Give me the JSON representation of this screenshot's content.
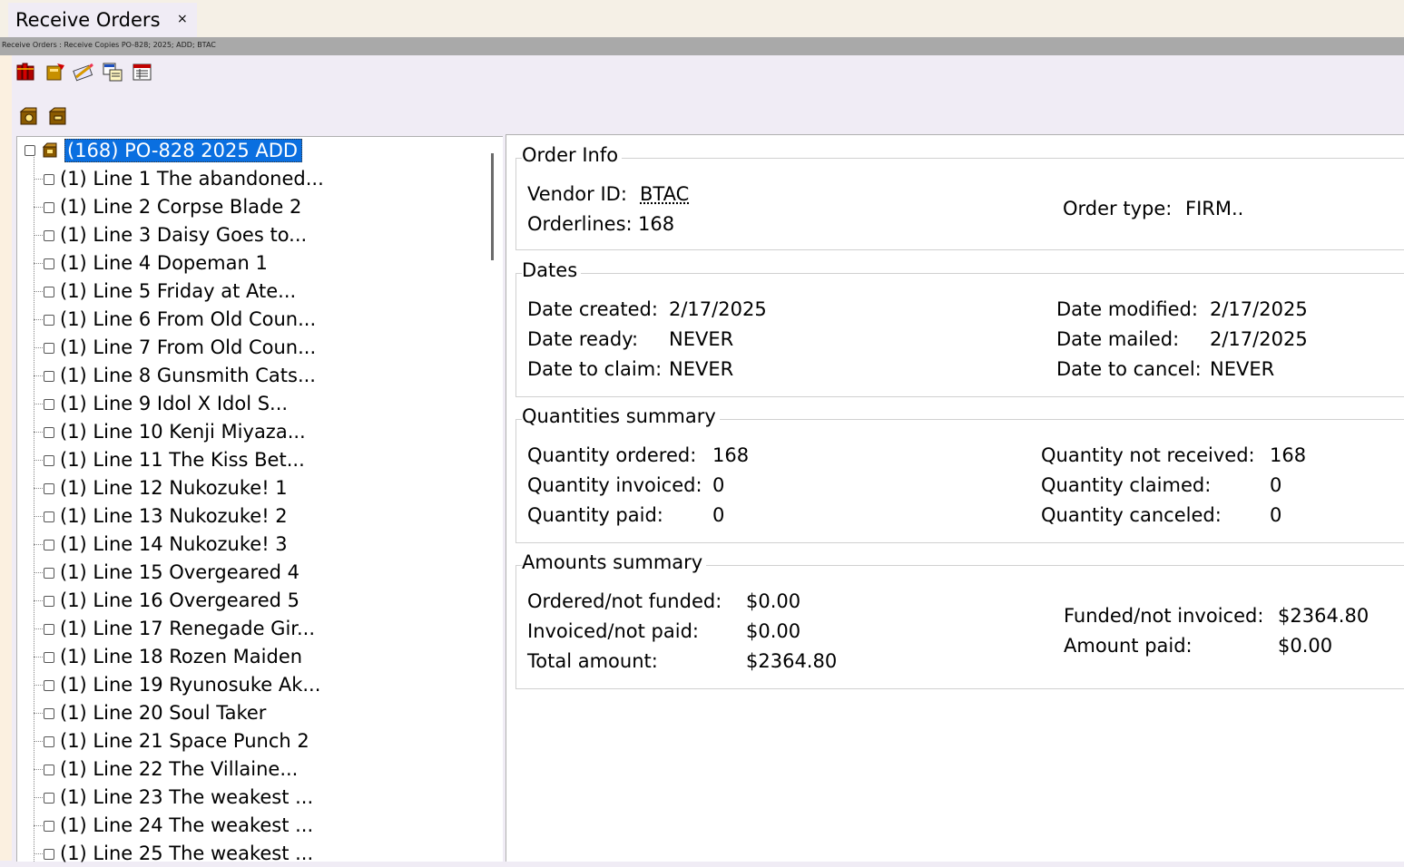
{
  "tab": {
    "title": "Receive Orders",
    "close": "×"
  },
  "breadcrumb": "Receive Orders : Receive Copies  PO-828; 2025; ADD; BTAC",
  "tree": {
    "root": "(168) PO-828 2025 ADD",
    "lines": [
      "(1) Line 1 The abandoned...",
      "(1) Line 2 Corpse Blade 2",
      "(1) Line 3 Daisy Goes to...",
      "(1) Line 4 Dopeman 1",
      "(1) Line 5 Friday at Ate...",
      "(1) Line 6 From Old Coun...",
      "(1) Line 7 From Old Coun...",
      "(1) Line 8 Gunsmith Cats...",
      "(1) Line 9 Idol X Idol S...",
      "(1) Line 10 Kenji Miyaza...",
      "(1) Line 11 The Kiss Bet...",
      "(1) Line 12 Nukozuke! 1",
      "(1) Line 13 Nukozuke! 2",
      "(1) Line 14 Nukozuke! 3",
      "(1) Line 15 Overgeared 4",
      "(1) Line 16 Overgeared 5",
      "(1) Line 17 Renegade Gir...",
      "(1) Line 18 Rozen Maiden",
      "(1) Line 19 Ryunosuke Ak...",
      "(1) Line 20 Soul Taker",
      "(1) Line 21 Space Punch 2",
      "(1) Line 22 The Villaine...",
      "(1) Line 23 The weakest ...",
      "(1) Line 24 The weakest ...",
      "(1) Line 25 The weakest ..."
    ]
  },
  "order_info": {
    "heading": "Order Info",
    "vendor_label": "Vendor ID:",
    "vendor_value": "BTAC",
    "orderlines_label": "Orderlines:",
    "orderlines_value": "168",
    "order_type_label": "Order type:",
    "order_type_value": "FIRM.."
  },
  "dates": {
    "heading": "Dates",
    "created_label": "Date created:",
    "created_value": "2/17/2025",
    "ready_label": "Date ready:",
    "ready_value": "NEVER",
    "claim_label": "Date to claim:",
    "claim_value": "NEVER",
    "modified_label": "Date modified:",
    "modified_value": "2/17/2025",
    "mailed_label": "Date mailed:",
    "mailed_value": "2/17/2025",
    "cancel_label": "Date to cancel:",
    "cancel_value": "NEVER"
  },
  "quantities": {
    "heading": "Quantities summary",
    "ordered_label": "Quantity ordered:",
    "ordered_value": "168",
    "invoiced_label": "Quantity invoiced:",
    "invoiced_value": "0",
    "paid_label": "Quantity paid:",
    "paid_value": "0",
    "not_received_label": "Quantity not received:",
    "not_received_value": "168",
    "claimed_label": "Quantity claimed:",
    "claimed_value": "0",
    "canceled_label": "Quantity canceled:",
    "canceled_value": "0"
  },
  "amounts": {
    "heading": "Amounts summary",
    "ordered_nf_label": "Ordered/not funded:",
    "ordered_nf_value": "$0.00",
    "invoiced_np_label": "Invoiced/not paid:",
    "invoiced_np_value": "$0.00",
    "total_label": "Total amount:",
    "total_value": "$2364.80",
    "funded_ni_label": "Funded/not invoiced:",
    "funded_ni_value": "$2364.80",
    "amount_paid_label": "Amount paid:",
    "amount_paid_value": "$0.00"
  },
  "icons": {
    "toolbar": [
      "books-icon",
      "checkout-book-icon",
      "pencil-card-icon",
      "copy-record-icon",
      "calendar-report-icon"
    ],
    "secondary": [
      "receive-box-icon",
      "unreceive-box-icon"
    ],
    "selection_color": "#0a6fe0"
  }
}
